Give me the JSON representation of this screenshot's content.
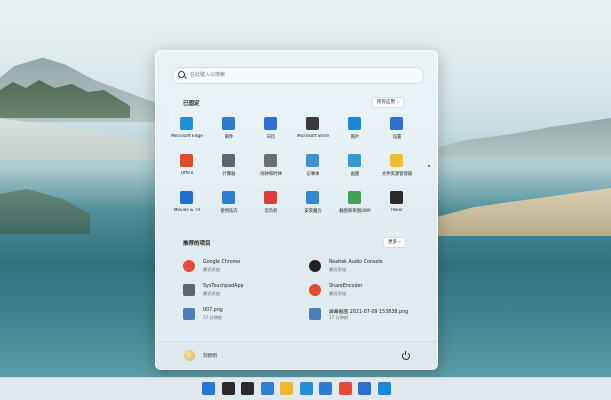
{
  "search": {
    "placeholder": "在此键入以搜索"
  },
  "pinned": {
    "title": "已固定",
    "all_apps_label": "所有应用",
    "apps": [
      {
        "label": "Microsoft Edge",
        "icon": "edge-icon",
        "color": "#1f8fd6"
      },
      {
        "label": "邮件",
        "icon": "mail-icon",
        "color": "#2d7bd3"
      },
      {
        "label": "日历",
        "icon": "calendar-icon",
        "color": "#2f6fd2"
      },
      {
        "label": "Microsoft Store",
        "icon": "store-icon",
        "color": "#3b3b3b"
      },
      {
        "label": "照片",
        "icon": "photos-icon",
        "color": "#1a88d6"
      },
      {
        "label": "设置",
        "icon": "gear-icon",
        "color": "#2c6fd0"
      },
      {
        "label": "Office",
        "icon": "office-icon",
        "color": "#e24b2a"
      },
      {
        "label": "计算器",
        "icon": "calculator-icon",
        "color": "#5b6770"
      },
      {
        "label": "闹钟和时钟",
        "icon": "clock-icon",
        "color": "#6e6e6e"
      },
      {
        "label": "记事本",
        "icon": "notepad-icon",
        "color": "#3a93d6"
      },
      {
        "label": "画图",
        "icon": "paint-icon",
        "color": "#2e9ad6"
      },
      {
        "label": "文件资源管理器",
        "icon": "folder-icon",
        "color": "#f2be2a"
      },
      {
        "label": "Movies & TV",
        "icon": "movies-icon",
        "color": "#1f6fcf"
      },
      {
        "label": "使用技巧",
        "icon": "tips-icon",
        "color": "#2a7fd4"
      },
      {
        "label": "云负荷",
        "icon": "cloud-app-icon",
        "color": "#e03b3b"
      },
      {
        "label": "安装魔方",
        "icon": "cube-icon",
        "color": "#2f85d6"
      },
      {
        "label": "截图和草图UWP",
        "icon": "snip-icon",
        "color": "#3fa05a"
      },
      {
        "label": "Poker",
        "icon": "poker-icon",
        "color": "#2a2a2a"
      }
    ]
  },
  "recommended": {
    "title": "推荐的项目",
    "more_label": "更多",
    "items": [
      {
        "title": "Google Chrome",
        "subtitle": "最近添加",
        "icon": "chrome-icon",
        "color": "#e64a3b"
      },
      {
        "title": "Realtek Audio Console",
        "subtitle": "最近添加",
        "icon": "audio-icon",
        "color": "#222222"
      },
      {
        "title": "SysTouchpadApp",
        "subtitle": "最近添加",
        "icon": "touchpad-icon",
        "color": "#5a6570"
      },
      {
        "title": "ShareEncoder",
        "subtitle": "最近添加",
        "icon": "encoder-icon",
        "color": "#e04a2e"
      },
      {
        "title": "007.png",
        "subtitle": "17 分钟前",
        "icon": "image-file-icon",
        "color": "#4c7fb8"
      },
      {
        "title": "屏幕截图 2021-07-09 153838.png",
        "subtitle": "17 分钟前",
        "icon": "image-file-icon",
        "color": "#4c7fb8"
      }
    ]
  },
  "user": {
    "name": "刘新明"
  },
  "taskbar": [
    {
      "icon": "windows-icon",
      "color": "#1e78d6"
    },
    {
      "icon": "search-icon",
      "color": "#2a2a2a"
    },
    {
      "icon": "task-view-icon",
      "color": "#2a2a2a"
    },
    {
      "icon": "widgets-icon",
      "color": "#2d7fd8"
    },
    {
      "icon": "folder-icon",
      "color": "#f0b929"
    },
    {
      "icon": "edge-icon",
      "color": "#1f8fd6"
    },
    {
      "icon": "mail-icon",
      "color": "#2d7bd3"
    },
    {
      "icon": "chrome-icon",
      "color": "#e64a3b"
    },
    {
      "icon": "gear-icon",
      "color": "#2c6fd0"
    },
    {
      "icon": "photos-icon",
      "color": "#1a88d6"
    }
  ]
}
